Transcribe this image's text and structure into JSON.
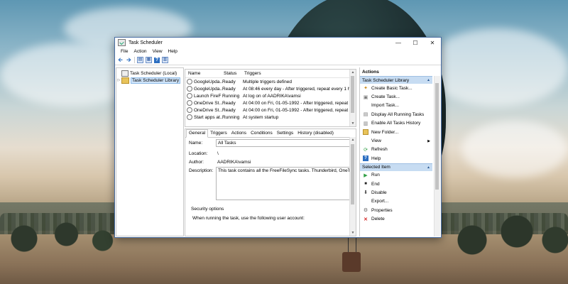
{
  "window": {
    "title": "Task Scheduler",
    "minimize": "—",
    "maximize": "☐",
    "close": "✕"
  },
  "menu": [
    "File",
    "Action",
    "View",
    "Help"
  ],
  "tree": {
    "root": "Task Scheduler (Local)",
    "library": "Task Scheduler Library"
  },
  "tasklist": {
    "headers": {
      "name": "Name",
      "status": "Status",
      "triggers": "Triggers"
    },
    "rows": [
      {
        "name": "GoogleUpda...",
        "status": "Ready",
        "trigger": "Multiple triggers defined"
      },
      {
        "name": "GoogleUpda...",
        "status": "Ready",
        "trigger": "At 08:46 every day - After triggered, repeat every 1 hour"
      },
      {
        "name": "Launch FireF",
        "status": "Running",
        "trigger": "At log on of AADRIKA\\vamsi"
      },
      {
        "name": "OneDrive St...",
        "status": "Ready",
        "trigger": "At 04:00 on Fri, 01-05-1992 - After triggered, repeat every"
      },
      {
        "name": "OneDrive St...",
        "status": "Ready",
        "trigger": "At 04:00 on Fri, 01-05-1992 - After triggered, repeat every"
      },
      {
        "name": "Start apps at...",
        "status": "Running",
        "trigger": "At system startup"
      }
    ]
  },
  "tabs": [
    "General",
    "Triggers",
    "Actions",
    "Conditions",
    "Settings",
    "History (disabled)"
  ],
  "general": {
    "name_label": "Name:",
    "name_value": "All Tasks",
    "location_label": "Location:",
    "location_value": "\\",
    "author_label": "Author:",
    "author_value": "AADRIKA\\vamsi",
    "description_label": "Description:",
    "description_value": "This task contains all the FreeFileSync tasks. Thunderbird, OneTab Ex",
    "security_label": "Security options",
    "security_text": "When running the task, use the following user account:"
  },
  "actions": {
    "title": "Actions",
    "group1": "Task Scheduler Library",
    "group1_items": [
      "Create Basic Task...",
      "Create Task...",
      "Import Task...",
      "Display All Running Tasks",
      "Enable All Tasks History",
      "New Folder...",
      "View",
      "Refresh",
      "Help"
    ],
    "group2": "Selected Item",
    "group2_items": [
      "Run",
      "End",
      "Disable",
      "Export...",
      "Properties",
      "Delete"
    ]
  }
}
